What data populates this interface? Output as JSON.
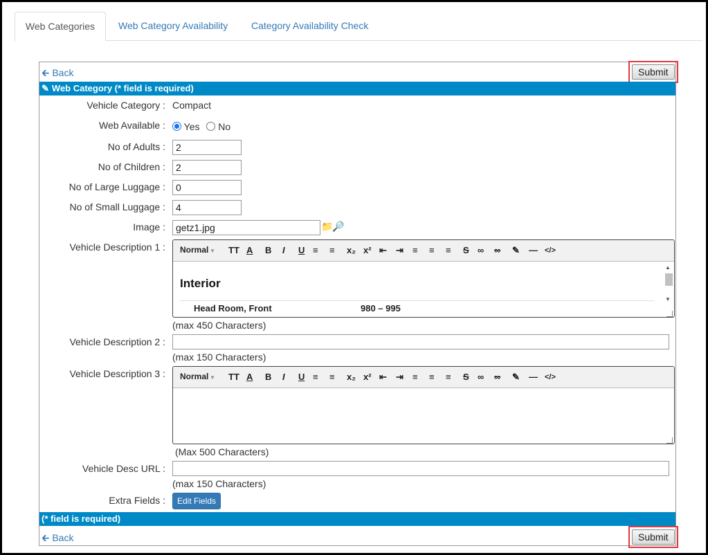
{
  "tabs": [
    {
      "label": "Web Categories",
      "active": true
    },
    {
      "label": "Web Category Availability",
      "active": false
    },
    {
      "label": "Category Availability Check",
      "active": false
    }
  ],
  "nav": {
    "back_label": "Back",
    "submit_label": "Submit"
  },
  "header_bar": {
    "title": "Web Category (* field is required)"
  },
  "footer_bar": {
    "title": "(* field is required)"
  },
  "form": {
    "vehicle_category": {
      "label": "Vehicle Category :",
      "value": "Compact"
    },
    "web_available": {
      "label": "Web Available :",
      "options": [
        "Yes",
        "No"
      ],
      "selected": "Yes"
    },
    "adults": {
      "label": "No of Adults :",
      "value": "2"
    },
    "children": {
      "label": "No of Children :",
      "value": "2"
    },
    "large_luggage": {
      "label": "No of Large Luggage :",
      "value": "0"
    },
    "small_luggage": {
      "label": "No of Small Luggage :",
      "value": "4"
    },
    "image": {
      "label": "Image :",
      "value": "getz1.jpg"
    },
    "desc1": {
      "label": "Vehicle Description 1 :",
      "hint": "(max 450 Characters)",
      "heading": "Interior",
      "row_label": "Head Room, Front",
      "row_value": "980 – 995"
    },
    "desc2": {
      "label": "Vehicle Description 2 :",
      "value": "",
      "hint": "(max 150 Characters)"
    },
    "desc3": {
      "label": "Vehicle Description 3 :",
      "hint": "(Max 500 Characters)"
    },
    "desc_url": {
      "label": "Vehicle Desc URL :",
      "value": "",
      "hint": "(max 150 Characters)"
    },
    "extra_fields": {
      "label": "Extra Fields :",
      "button_label": "Edit Fields"
    }
  },
  "editor_toolbar": {
    "format_label": "Normal"
  },
  "colors": {
    "accent": "#0089c7",
    "link": "#337ab7",
    "highlight": "#e0393e"
  }
}
